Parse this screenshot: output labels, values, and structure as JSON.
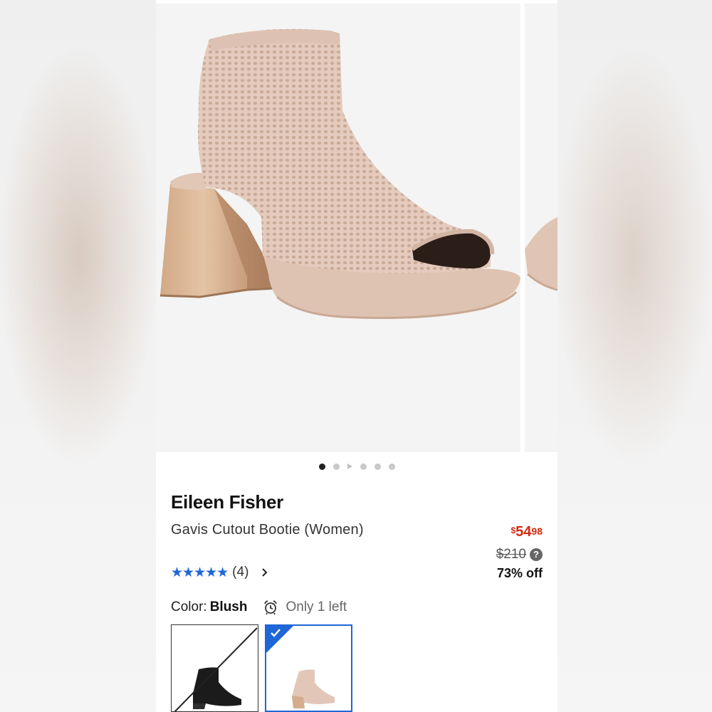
{
  "gallery": {
    "dots": [
      "dot",
      "dot",
      "play",
      "dot",
      "dot",
      "dot"
    ],
    "active_index": 0
  },
  "product": {
    "brand": "Eileen Fisher",
    "name": "Gavis Cutout Bootie (Women)",
    "rating_stars": "★★★★★",
    "rating_value": 5,
    "rating_count": "(4)"
  },
  "pricing": {
    "currency_symbol": "$",
    "sale_dollars": "54",
    "sale_cents": "98",
    "original_price": "$210",
    "help_symbol": "?",
    "discount": "73% off",
    "sale_color": "#d32b0f"
  },
  "color": {
    "label": "Color:",
    "value": "Blush",
    "stock_text": "Only 1 left",
    "stock_icon": "alarm-clock-icon"
  },
  "swatches": [
    {
      "color_name": "black",
      "available": false,
      "selected": false
    },
    {
      "color_name": "blush",
      "available": true,
      "selected": true
    }
  ],
  "theme": {
    "accent": "#1f66d6",
    "shoe_knit": "#e3c9bb",
    "heel_wood": "#d8b28e"
  }
}
